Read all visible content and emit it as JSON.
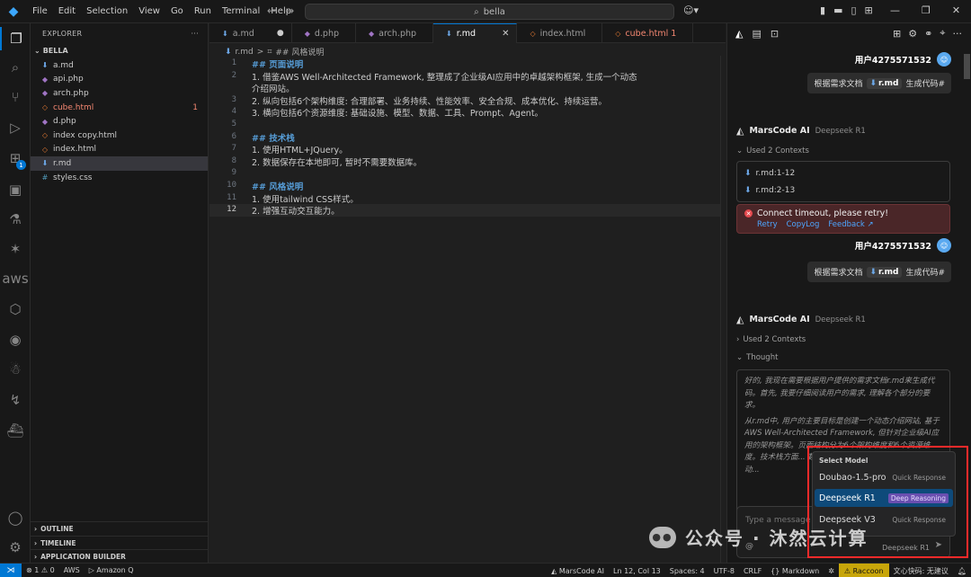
{
  "titlebar": {
    "menu": [
      "File",
      "Edit",
      "Selection",
      "View",
      "Go",
      "Run",
      "Terminal",
      "Help"
    ],
    "search": "bella"
  },
  "activity": {
    "extensions_badge": "1"
  },
  "explorer": {
    "header": "EXPLORER",
    "folder": "BELLA",
    "files": [
      {
        "name": "a.md",
        "icon": "markdown-icon"
      },
      {
        "name": "api.php",
        "icon": "php-icon"
      },
      {
        "name": "arch.php",
        "icon": "php-icon"
      },
      {
        "name": "cube.html",
        "icon": "html-icon",
        "error": true,
        "count": "1"
      },
      {
        "name": "d.php",
        "icon": "php-icon"
      },
      {
        "name": "index copy.html",
        "icon": "html-icon"
      },
      {
        "name": "index.html",
        "icon": "html-icon"
      },
      {
        "name": "r.md",
        "icon": "markdown-icon",
        "selected": true
      },
      {
        "name": "styles.css",
        "icon": "css-icon"
      }
    ],
    "sections": [
      "OUTLINE",
      "TIMELINE",
      "APPLICATION BUILDER"
    ]
  },
  "tabs": [
    {
      "name": "a.md",
      "state": "dirty"
    },
    {
      "name": "d.php"
    },
    {
      "name": "arch.php"
    },
    {
      "name": "r.md",
      "active": true
    },
    {
      "name": "index.html"
    },
    {
      "name": "cube.html 1",
      "error": true
    }
  ],
  "breadcrumb": {
    "file": "r.md",
    "sep": ">",
    "section": "## 风格说明"
  },
  "editor": {
    "current_line": 12,
    "lines": [
      {
        "n": "1",
        "text": "## 页面说明",
        "kind": "heading"
      },
      {
        "n": "2",
        "text": "1. 借鉴AWS Well-Architected Framework, 整理成了企业级AI应用中的卓越架构框架, 生成一个动态",
        "kind": "list"
      },
      {
        "n": "",
        "text": "介绍网站。",
        "kind": "wrap"
      },
      {
        "n": "3",
        "text": "2. 纵向包括6个架构维度: 合理部署、业务持续、性能效率、安全合规、成本优化、持续运营。",
        "kind": "list"
      },
      {
        "n": "4",
        "text": "3. 横向包括6个资源维度: 基础设施、模型、数据、工具、Prompt、Agent。",
        "kind": "list"
      },
      {
        "n": "5",
        "text": "",
        "kind": "blank"
      },
      {
        "n": "6",
        "text": "## 技术栈",
        "kind": "heading"
      },
      {
        "n": "7",
        "text": "1. 使用HTML+JQuery。",
        "kind": "list"
      },
      {
        "n": "8",
        "text": "2. 数据保存在本地即可, 暂时不需要数据库。",
        "kind": "list"
      },
      {
        "n": "9",
        "text": "",
        "kind": "blank"
      },
      {
        "n": "10",
        "text": "## 风格说明",
        "kind": "heading"
      },
      {
        "n": "11",
        "text": "1. 使用tailwind CSS样式。",
        "kind": "list"
      },
      {
        "n": "12",
        "text": "2. 增强互动交互能力。",
        "kind": "list"
      }
    ]
  },
  "chat": {
    "user_name": "用户4275571532",
    "request_prefix": "根据需求文档",
    "request_file": "r.md",
    "request_suffix": "生成代码#",
    "ai_name": "MarsCode AI",
    "model": "Deepseek R1",
    "contexts_label": "Used 2 Contexts",
    "contexts": [
      "r.md:1-12",
      "r.md:2-13"
    ],
    "error_msg": "Connect timeout, please retry!",
    "error_links": [
      "Retry",
      "CopyLog",
      "Feedback ↗"
    ],
    "thought_label": "Thought",
    "thought_p1": "好的, 我现在需要根据用户提供的需求文档r.md来生成代码。首先, 我要仔细阅读用户的需求, 理解各个部分的要求。",
    "thought_p2": "从r.md中, 用户的主要目标是创建一个动态介绍网站, 基于AWS Well-Architected Framework, 但针对企业级AI应用的架构框架。页面结构分为6个架构维度和6个资源维度。技术栈方面... 数据存储在本地, 不... S, 并强调增强互动...",
    "input_placeholder": "Type a message",
    "input_at": "@",
    "input_model": "Deepseek R1"
  },
  "model_menu": {
    "title": "Select Model",
    "options": [
      {
        "name": "Doubao-1.5-pro",
        "tag": "Quick Response"
      },
      {
        "name": "Deepseek R1",
        "tag": "Deep Reasoning",
        "selected": true
      },
      {
        "name": "Deepseek V3",
        "tag": "Quick Response"
      }
    ]
  },
  "watermark": {
    "text": "公众号 · 沐然云计算",
    "icon": "wechat-icon"
  },
  "statusbar": {
    "errors": "⊗ 1 ⚠ 0",
    "aws": "AWS",
    "amazonq": "Amazon Q",
    "marscode": "MarsCode AI",
    "position": "Ln 12, Col 13",
    "spaces": "Spaces: 4",
    "encoding": "UTF-8",
    "eol": "CRLF",
    "language": "Markdown",
    "raccoon": "Raccoon",
    "wenxin": "文心快码: 无建议"
  },
  "colors": {
    "accent": "#0078d4",
    "error": "#f48771",
    "heading": "#569cd6",
    "highlight": "#ff2a2a"
  }
}
